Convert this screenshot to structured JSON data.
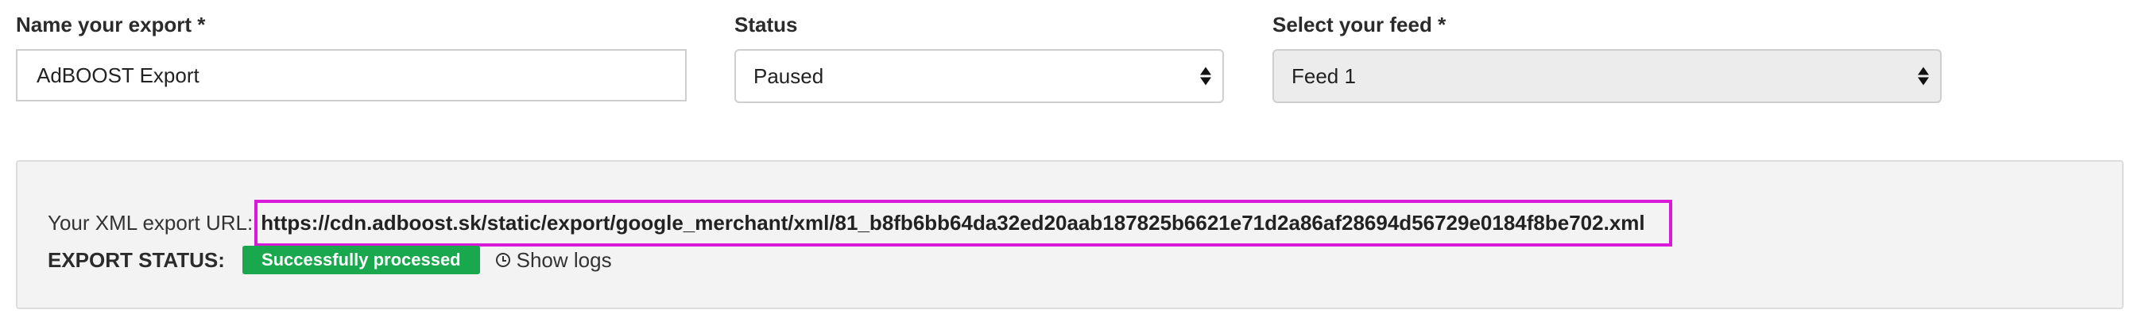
{
  "form": {
    "name_label": "Name your export *",
    "name_value": "AdBOOST Export",
    "status_label": "Status",
    "status_value": "Paused",
    "feed_label": "Select your feed *",
    "feed_value": "Feed 1"
  },
  "export_info": {
    "url_label": "Your XML export URL:",
    "url_value": "https://cdn.adboost.sk/static/export/google_merchant/xml/81_b8fb6bb64da32ed20aab187825b6621e71d2a86af28694d56729e0184f8be702.xml",
    "status_label": "EXPORT STATUS:",
    "status_badge": "Successfully processed",
    "logs_link": "Show logs"
  },
  "colors": {
    "highlight_border": "#d81ad8",
    "success_badge": "#1aa84f",
    "panel_background": "#f3f3f3"
  },
  "icons": {
    "select_arrows": "chevron-up-down-icon",
    "logs": "clock-icon"
  }
}
